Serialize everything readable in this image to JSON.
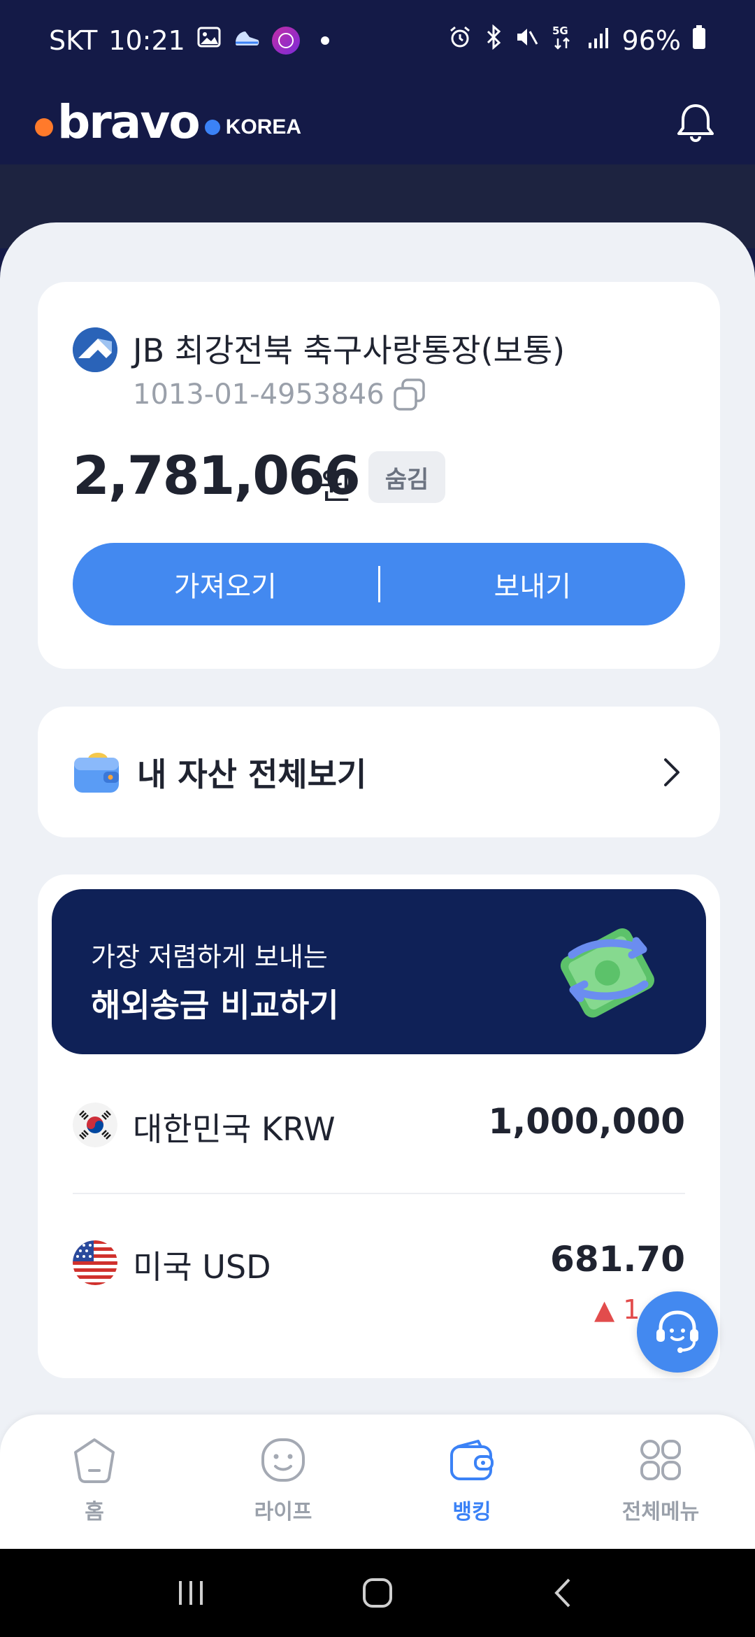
{
  "status_bar": {
    "carrier": "SKT",
    "time": "10:21",
    "battery": "96%"
  },
  "header": {
    "logo_text": "bravo",
    "logo_sub": "KOREA"
  },
  "account": {
    "name": "JB 최강전북 축구사랑통장(보통)",
    "number": "1013-01-4953846",
    "balance": "2,781,066",
    "unit": "원",
    "hide_label": "숨김",
    "action_left": "가져오기",
    "action_right": "보내기"
  },
  "assets": {
    "label": "내 자산 전체보기"
  },
  "promo": {
    "subtitle": "가장 저렴하게 보내는",
    "title": "해외송금 비교하기"
  },
  "currencies": [
    {
      "name": "대한민국 KRW",
      "amount": "1,000,000"
    },
    {
      "name": "미국 USD",
      "amount": "681.70",
      "change": "▲ 1.47"
    }
  ],
  "bottom_nav": [
    {
      "label": "홈"
    },
    {
      "label": "라이프"
    },
    {
      "label": "뱅킹"
    },
    {
      "label": "전체메뉴"
    }
  ],
  "colors": {
    "primary": "#4389f0",
    "header_bg": "#141a47",
    "promo_bg": "#0f2157",
    "rate_up": "#e24c4c"
  }
}
